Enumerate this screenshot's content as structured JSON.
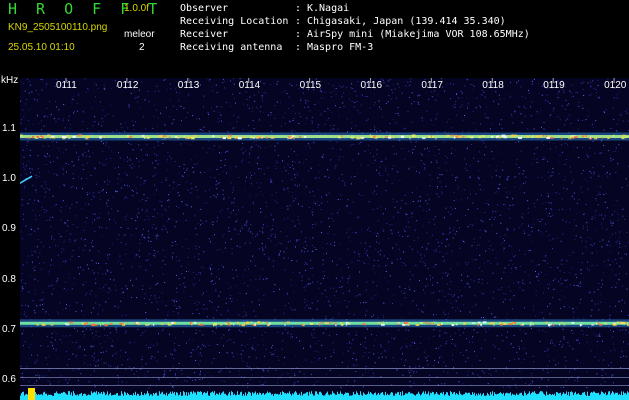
{
  "app": {
    "title": "H R O F F T",
    "version": "1.0.0f"
  },
  "file": {
    "name": "KN9_2505100110.png",
    "datetime": "25.05.10 01:10"
  },
  "metric": {
    "label": "meleor",
    "value": "2"
  },
  "info": [
    {
      "label": "Observer",
      "value": "K.Nagai"
    },
    {
      "label": "Receiving Location",
      "value": "Chigasaki, Japan (139.414 35.340)"
    },
    {
      "label": "Receiver",
      "value": "AirSpy mini (Miakejima VOR 108.65MHz)"
    },
    {
      "label": "Receiving antenna",
      "value": "Maspro FM-3"
    }
  ],
  "colors": {
    "title_green": "#33d633",
    "meta_yellow": "#d8d800",
    "background_plot": "#050523"
  },
  "chart_data": {
    "type": "heatmap",
    "ylabel": "kHz",
    "y_ticks": [
      "1.1",
      "1.0",
      "0.9",
      "0.8",
      "0.7",
      "0.6"
    ],
    "x_ticks": [
      "0111",
      "0112",
      "0113",
      "0114",
      "0115",
      "0116",
      "0117",
      "0118",
      "0119",
      "0120"
    ],
    "signals_khz": [
      1.085,
      0.713
    ],
    "faint_lines_khz": [
      0.623,
      0.605,
      0.589
    ]
  }
}
